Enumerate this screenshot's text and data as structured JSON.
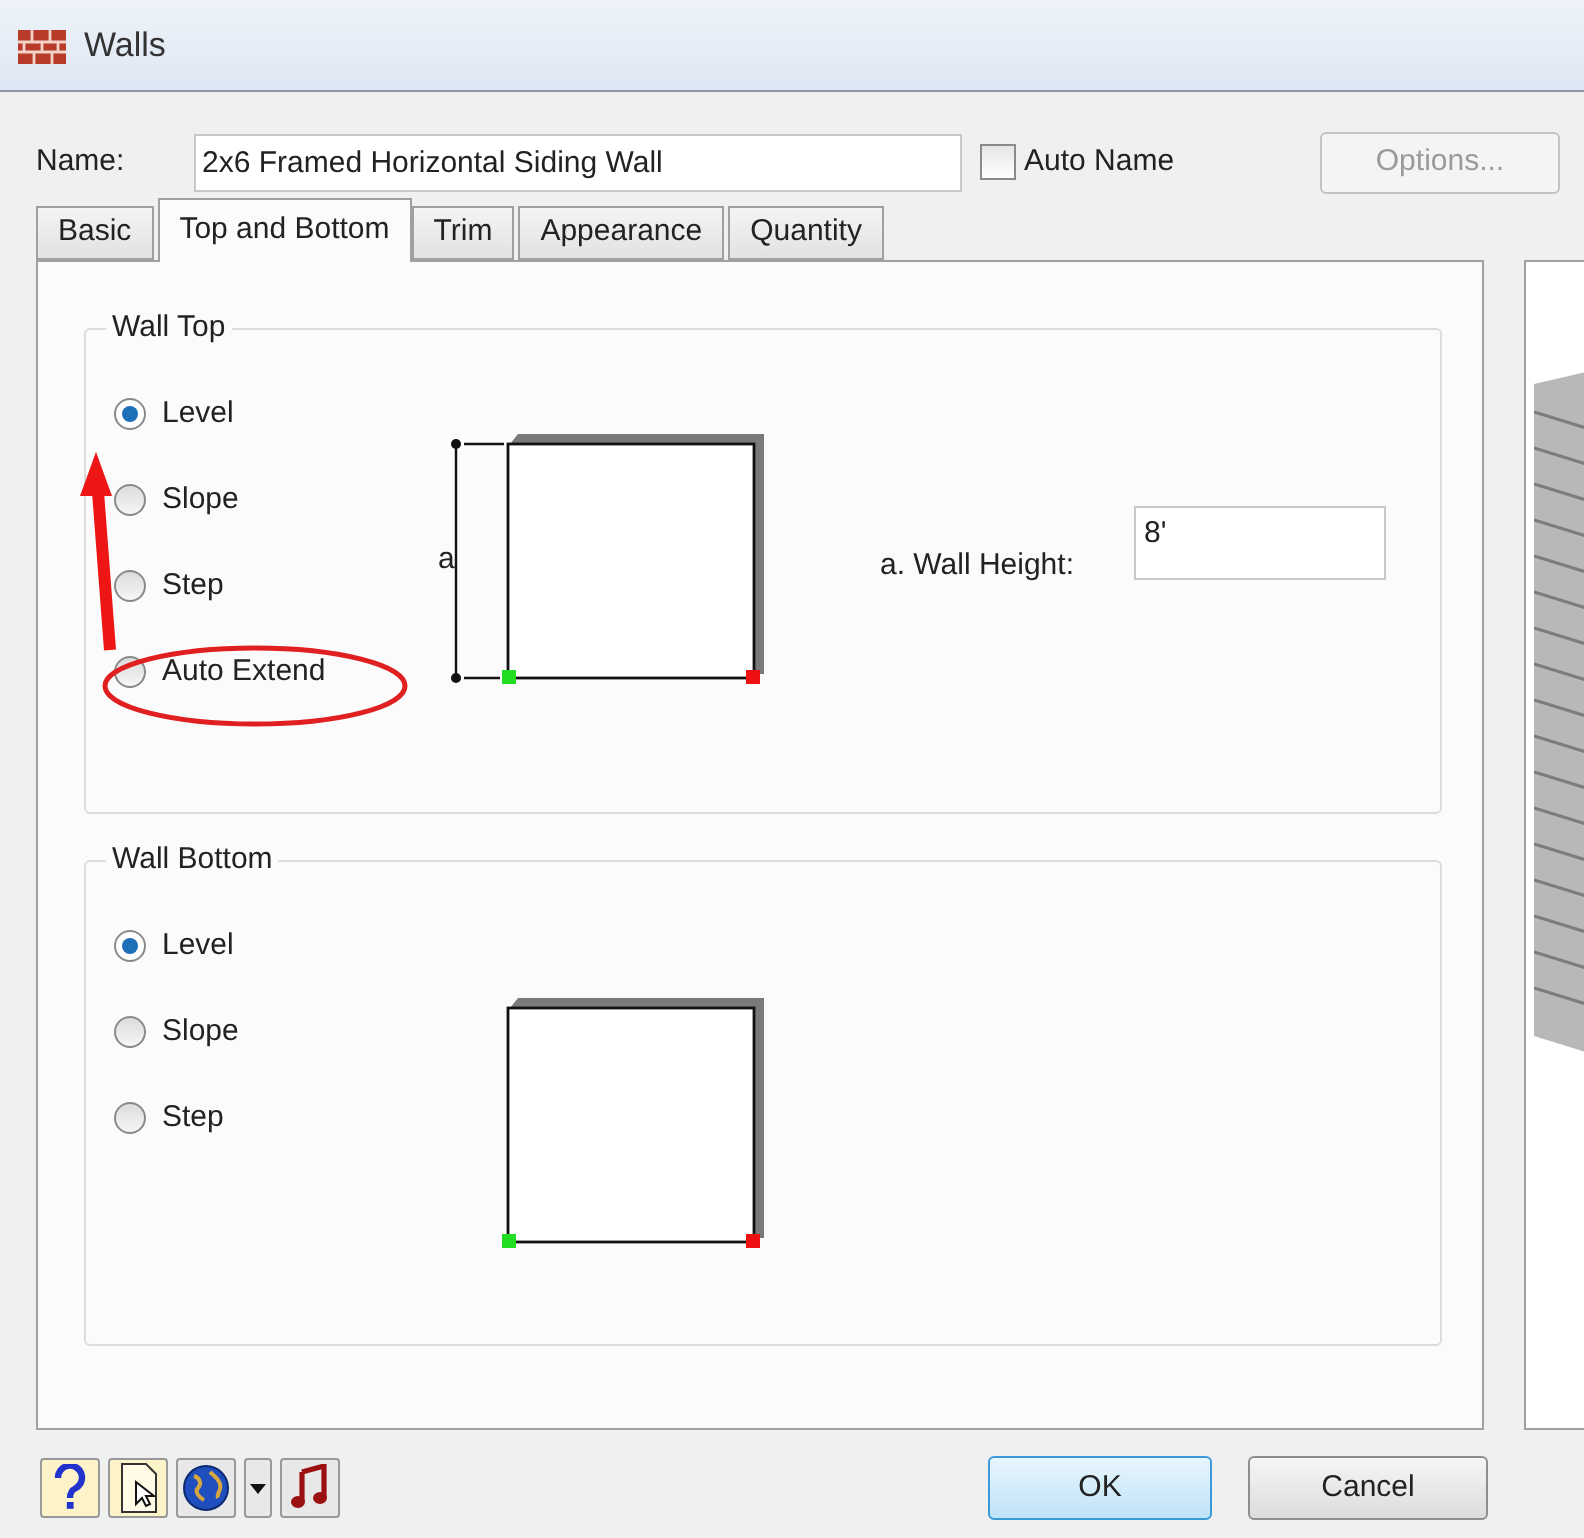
{
  "window": {
    "title": "Walls"
  },
  "name_field": {
    "label": "Name:",
    "value": "2x6 Framed Horizontal Siding Wall"
  },
  "auto_name": {
    "label": "Auto Name",
    "checked": false
  },
  "options_button": {
    "label": "Options...",
    "disabled": true
  },
  "tabs": [
    {
      "label": "Basic",
      "selected": false
    },
    {
      "label": "Top and Bottom",
      "selected": true
    },
    {
      "label": "Trim",
      "selected": false
    },
    {
      "label": "Appearance",
      "selected": false
    },
    {
      "label": "Quantity",
      "selected": false
    }
  ],
  "wall_top": {
    "title": "Wall Top",
    "options": [
      {
        "label": "Level",
        "selected": true
      },
      {
        "label": "Slope",
        "selected": false
      },
      {
        "label": "Step",
        "selected": false
      },
      {
        "label": "Auto Extend",
        "selected": false
      }
    ],
    "dimension_label": "a",
    "height_label": "a. Wall Height:",
    "height_value": "8'"
  },
  "wall_bottom": {
    "title": "Wall Bottom",
    "options": [
      {
        "label": "Level",
        "selected": true
      },
      {
        "label": "Slope",
        "selected": false
      },
      {
        "label": "Step",
        "selected": false
      }
    ]
  },
  "buttons": [
    {
      "label": "OK",
      "default": true
    },
    {
      "label": "Cancel",
      "default": false
    }
  ]
}
